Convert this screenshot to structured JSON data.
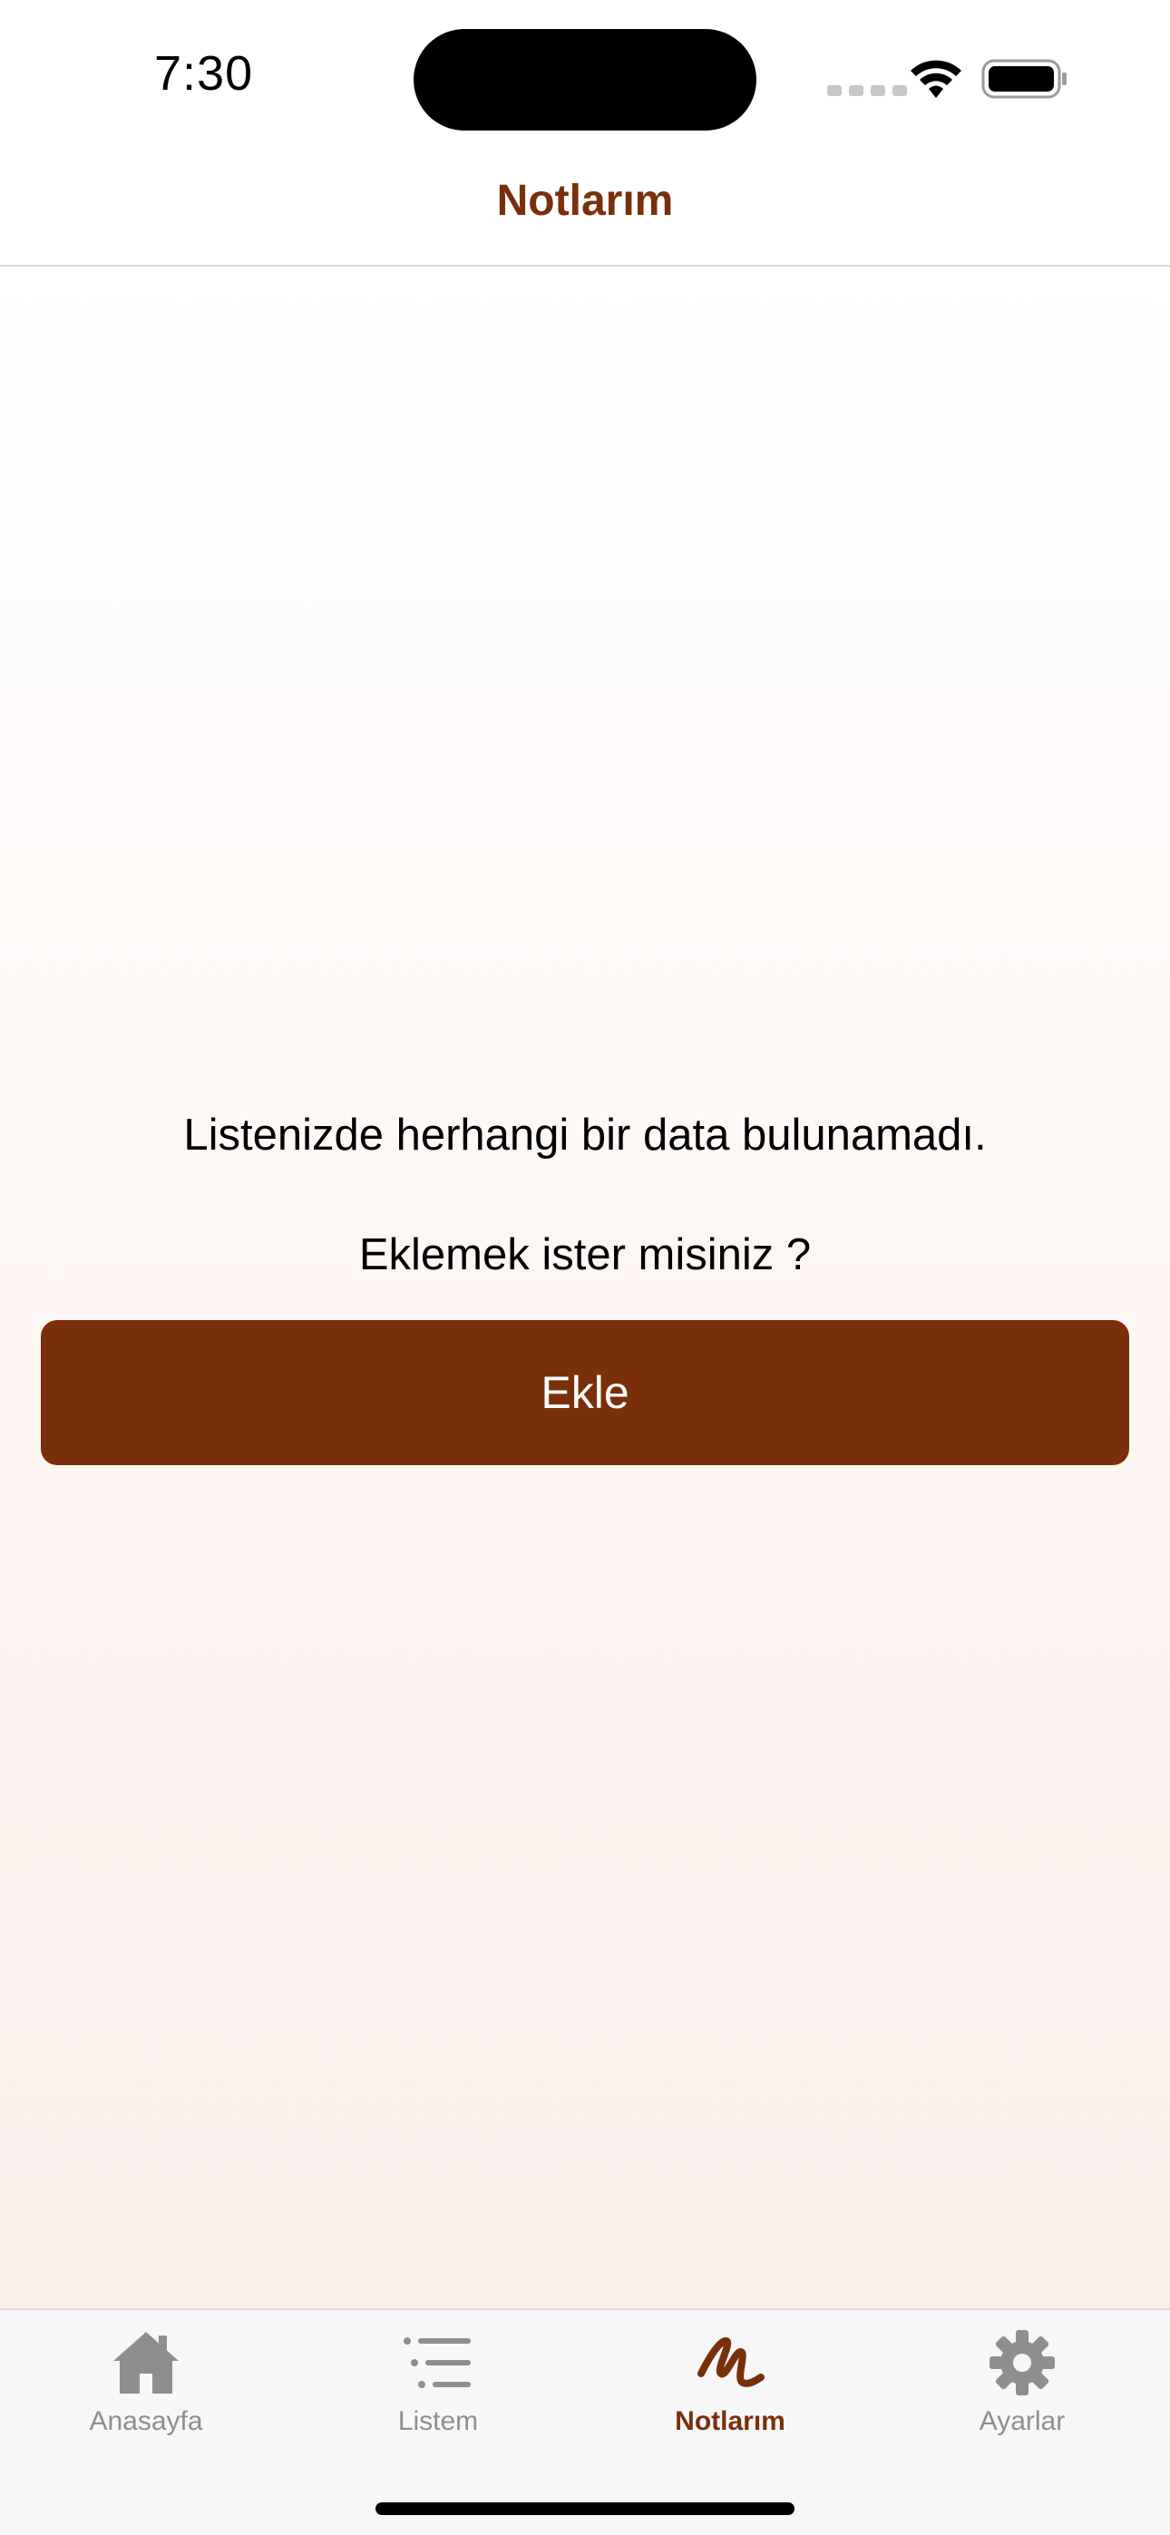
{
  "status_bar": {
    "time": "7:30"
  },
  "header": {
    "title": "Notlarım"
  },
  "empty_state": {
    "message": "Listenizde herhangi bir data bulunamadı.",
    "question": "Eklemek ister misiniz ?",
    "add_button_label": "Ekle"
  },
  "tab_bar": {
    "items": [
      {
        "label": "Anasayfa",
        "icon": "home-icon",
        "active": false
      },
      {
        "label": "Listem",
        "icon": "list-icon",
        "active": false
      },
      {
        "label": "Notlarım",
        "icon": "scribble-icon",
        "active": true
      },
      {
        "label": "Ayarlar",
        "icon": "gear-icon",
        "active": false
      }
    ]
  },
  "colors": {
    "accent": "#7a2f0b",
    "tab_inactive": "#8e8e8e",
    "tab_bar_background": "#f7f7f7"
  }
}
